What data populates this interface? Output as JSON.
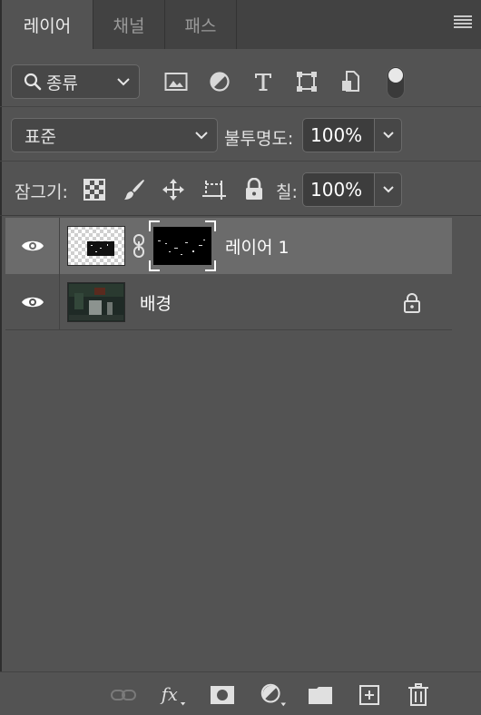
{
  "tabs": [
    {
      "label": "레이어",
      "active": true
    },
    {
      "label": "채널",
      "active": false
    },
    {
      "label": "패스",
      "active": false
    }
  ],
  "filter": {
    "kind_label": "종류",
    "icons": [
      "image-filter-icon",
      "adjustment-filter-icon",
      "type-filter-icon",
      "shape-filter-icon",
      "smart-object-filter-icon"
    ]
  },
  "blend": {
    "mode": "표준",
    "opacity_label": "불투명도:",
    "opacity_value": "100%"
  },
  "lock": {
    "label": "잠그기:",
    "fill_label": "칠:",
    "fill_value": "100%"
  },
  "layers": [
    {
      "name": "레이어 1",
      "selected": true,
      "visible": true,
      "has_mask": true,
      "locked": false
    },
    {
      "name": "배경",
      "selected": false,
      "visible": true,
      "has_mask": false,
      "locked": true
    }
  ],
  "footer_icons": [
    "link-layers-icon",
    "fx-icon",
    "add-mask-icon",
    "new-adjustment-icon",
    "new-group-icon",
    "new-layer-icon",
    "delete-layer-icon"
  ],
  "colors": {
    "panel_bg": "#535353",
    "tab_bar_bg": "#424242",
    "selected_row": "#6b6b6b"
  }
}
